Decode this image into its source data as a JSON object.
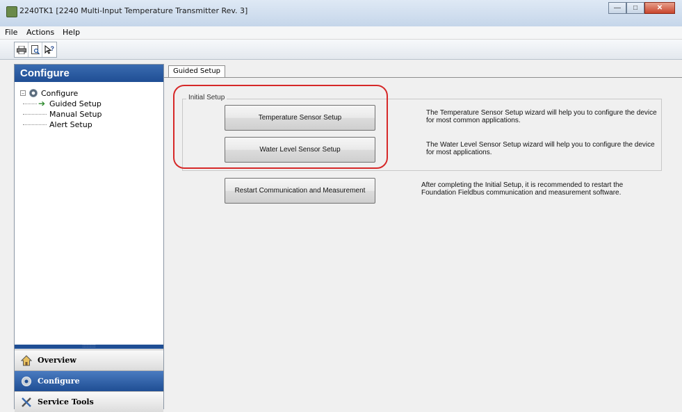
{
  "window": {
    "title": "2240TK1 [2240 Multi-Input Temperature Transmitter Rev. 3]",
    "buttons": [
      "minimize",
      "maximize",
      "close"
    ]
  },
  "menu": {
    "items": [
      "File",
      "Actions",
      "Help"
    ]
  },
  "toolbar": {
    "icons": [
      "print-icon",
      "print-preview-icon",
      "context-help-icon"
    ]
  },
  "left_pane": {
    "header": "Configure",
    "tree": {
      "root": "Configure",
      "children": [
        "Guided Setup",
        "Manual Setup",
        "Alert Setup"
      ],
      "selected": "Guided Setup"
    },
    "nav": [
      "Overview",
      "Configure",
      "Service Tools"
    ],
    "active_nav": "Configure"
  },
  "main": {
    "tab": "Guided Setup",
    "group_label": "Initial Setup",
    "buttons": {
      "temperature": "Temperature Sensor Setup",
      "water_level": "Water Level Sensor Setup",
      "restart": "Restart Communication and Measurement"
    },
    "descriptions": {
      "temperature": "The Temperature Sensor Setup wizard will help you to configure the device for most common applications.",
      "water_level": "The Water Level Sensor Setup wizard will help you to configure the device for most applications.",
      "restart": "After completing the Initial Setup, it is recommended to restart the Foundation Fieldbus communication and measurement software."
    }
  },
  "colors": {
    "header_blue": "#1f4e94",
    "highlight_red": "#d62828",
    "arrow_green": "#2e8a2e"
  }
}
